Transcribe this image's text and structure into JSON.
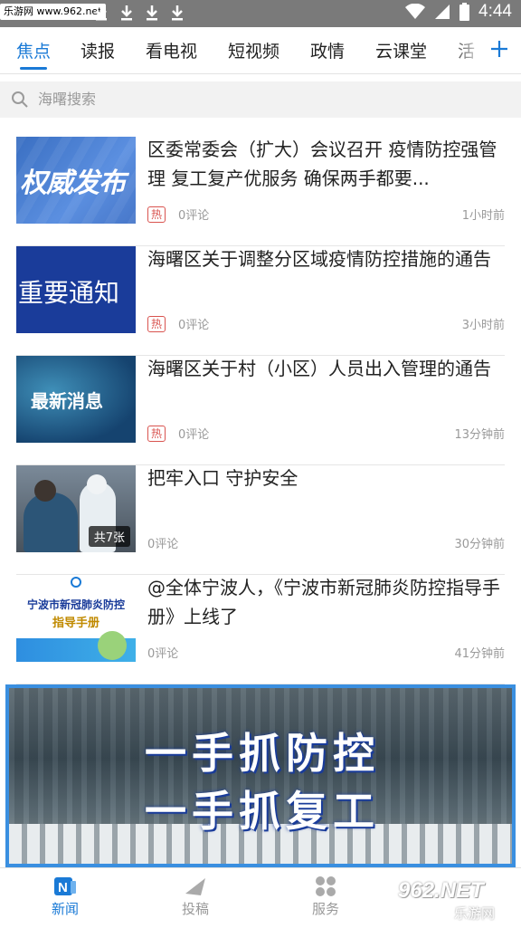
{
  "status_bar": {
    "watermark": "乐游网 www.962.net",
    "time": "4:44"
  },
  "tabs": [
    {
      "label": "焦点",
      "active": true
    },
    {
      "label": "读报"
    },
    {
      "label": "看电视"
    },
    {
      "label": "短视频"
    },
    {
      "label": "政情"
    },
    {
      "label": "云课堂"
    },
    {
      "label": "活"
    }
  ],
  "search": {
    "placeholder": "海曙搜索"
  },
  "news": [
    {
      "title": "区委常委会（扩大）会议召开 疫情防控强管理 复工复产优服务 确保两手都要...",
      "hot": "热",
      "comments": "0评论",
      "time": "1小时前",
      "thumb_text": "权威发布"
    },
    {
      "title": "海曙区关于调整分区域疫情防控措施的通告",
      "hot": "热",
      "comments": "0评论",
      "time": "3小时前",
      "thumb_text": "重要通知"
    },
    {
      "title": "海曙区关于村（小区）人员出入管理的通告",
      "hot": "热",
      "comments": "0评论",
      "time": "13分钟前",
      "thumb_text": "最新消息"
    },
    {
      "title": "把牢入口 守护安全",
      "comments": "0评论",
      "time": "30分钟前",
      "photo_count": "共7张"
    },
    {
      "title": "@全体宁波人，《宁波市新冠肺炎防控指导手册》上线了",
      "comments": "0评论",
      "time": "41分钟前",
      "thumb_text": "宁波市新冠肺炎防控",
      "thumb_sub": "指导手册"
    }
  ],
  "banner": {
    "line1": "一手抓防控",
    "line2": "一手抓复工"
  },
  "bottom_nav": [
    {
      "label": "新闻",
      "active": true
    },
    {
      "label": "投稿"
    },
    {
      "label": "服务"
    }
  ],
  "watermark_bottom": {
    "brand": "962.NET",
    "sub": "乐游网"
  },
  "colors": {
    "accent": "#1a7ad6",
    "hot": "#d9534f",
    "statusbar": "#7a7a7a"
  }
}
